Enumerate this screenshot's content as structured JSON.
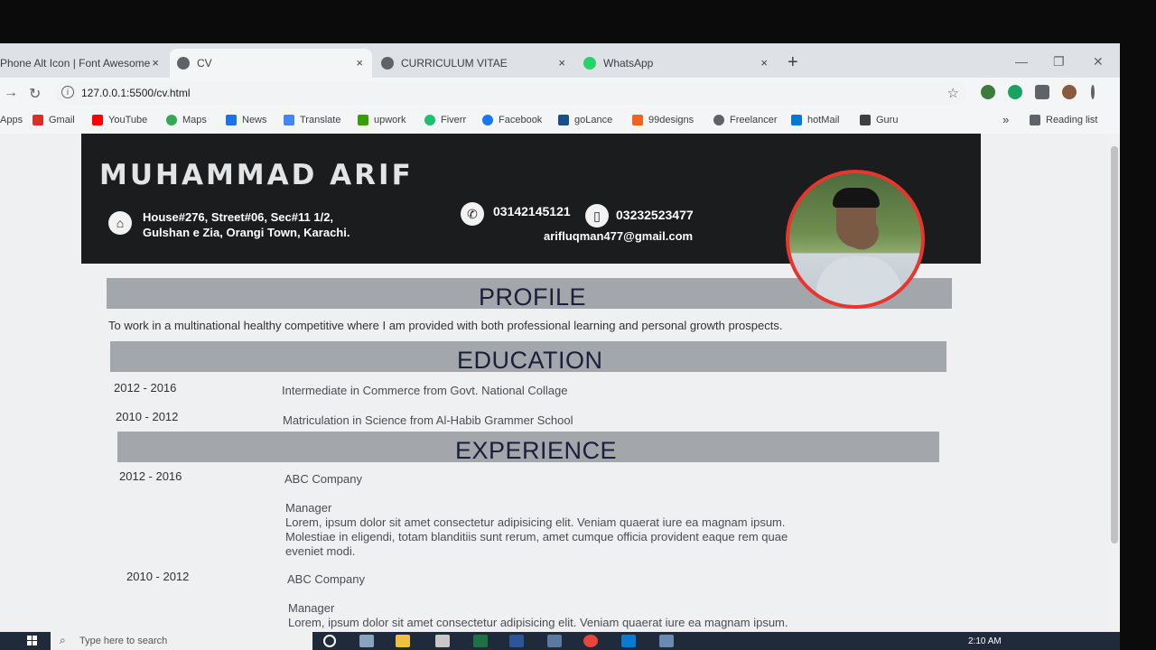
{
  "browser": {
    "tabs": [
      {
        "title": "Phone Alt Icon | Font Awesome",
        "close": "×"
      },
      {
        "title": "CV",
        "close": "×"
      },
      {
        "title": "CURRICULUM VITAE",
        "close": "×"
      },
      {
        "title": "WhatsApp",
        "close": "×"
      }
    ],
    "new_tab": "+",
    "url": "127.0.0.1:5500/cv.html",
    "bookmarks": [
      {
        "label": "Apps",
        "color": "#4285f4"
      },
      {
        "label": "Gmail",
        "color": "#d93025"
      },
      {
        "label": "YouTube",
        "color": "#ff0000"
      },
      {
        "label": "Maps",
        "color": "#34a853"
      },
      {
        "label": "News",
        "color": "#1a73e8"
      },
      {
        "label": "Translate",
        "color": "#4285f4"
      },
      {
        "label": "upwork",
        "color": "#37a000"
      },
      {
        "label": "Fiverr",
        "color": "#1dbf73"
      },
      {
        "label": "Facebook",
        "color": "#1877f2"
      },
      {
        "label": "goLance",
        "color": "#1a4e8c"
      },
      {
        "label": "99designs",
        "color": "#f26322"
      },
      {
        "label": "Freelancer",
        "color": "#5f6368"
      },
      {
        "label": "hotMail",
        "color": "#0078d4"
      },
      {
        "label": "Guru",
        "color": "#3c4043"
      }
    ],
    "more_bookmarks": "»",
    "reading_list": "Reading list"
  },
  "cv": {
    "name": "MUHAMMAD ARIF",
    "address_line1": "House#276, Street#06, Sec#11 1/2,",
    "address_line2": "Gulshan e Zia, Orangi Town, Karachi.",
    "phone1": "03142145121",
    "phone2": "03232523477",
    "email": "arifluqman477@gmail.com",
    "sections": {
      "profile": {
        "title": "PROFILE",
        "text": "To work in a multinational healthy competitive where I am provided with both professional learning and personal growth prospects."
      },
      "education": {
        "title": "EDUCATION",
        "items": [
          {
            "years": "2012 - 2016",
            "text": "Intermediate in Commerce from Govt. National Collage"
          },
          {
            "years": "2010 - 2012",
            "text": "Matriculation in Science from Al-Habib Grammer School"
          }
        ]
      },
      "experience": {
        "title": "EXPERIENCE",
        "items": [
          {
            "years": "2012 - 2016",
            "company": "ABC Company",
            "role": "Manager",
            "desc1": "Lorem, ipsum dolor sit amet consectetur adipisicing elit. Veniam quaerat iure ea magnam ipsum.",
            "desc2": "Molestiae in eligendi, totam blanditiis sunt rerum, amet cumque officia provident eaque rem quae",
            "desc3": "eveniet modi."
          },
          {
            "years": "2010 - 2012",
            "company": "ABC Company",
            "role": "Manager",
            "desc1": "Lorem, ipsum dolor sit amet consectetur adipisicing elit. Veniam quaerat iure ea magnam ipsum."
          }
        ]
      }
    }
  },
  "taskbar": {
    "search_placeholder": "Type here to search",
    "time": "2:10 AM"
  },
  "colors": {
    "header_bg": "#1b1c1d",
    "section_bar": "#a3a6ab",
    "section_title": "#1b1f3a",
    "avatar_border": "#e8362e"
  }
}
